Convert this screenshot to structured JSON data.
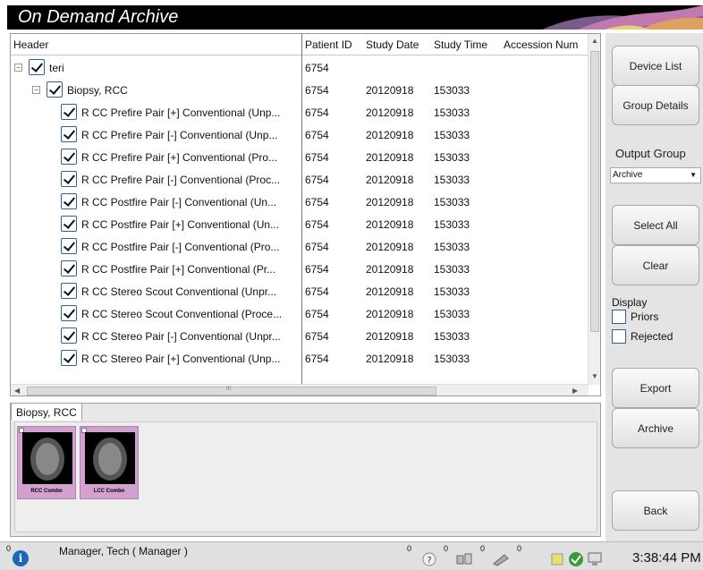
{
  "app": {
    "title": "On Demand Archive"
  },
  "tree": {
    "headers": [
      "Header",
      "Patient ID",
      "Study Date",
      "Study Time",
      "Accession Num"
    ],
    "rows": [
      {
        "label": "teri",
        "patient_id": "6754",
        "date": "",
        "time": "",
        "level": 0
      },
      {
        "label": "Biopsy, RCC",
        "patient_id": "6754",
        "date": "20120918",
        "time": "153033",
        "level": 1
      },
      {
        "label": "R CC Prefire Pair [+] Conventional (Unp...",
        "patient_id": "6754",
        "date": "20120918",
        "time": "153033",
        "level": 2
      },
      {
        "label": "R CC Prefire Pair [-] Conventional (Unp...",
        "patient_id": "6754",
        "date": "20120918",
        "time": "153033",
        "level": 2
      },
      {
        "label": "R CC Prefire Pair [+] Conventional (Pro...",
        "patient_id": "6754",
        "date": "20120918",
        "time": "153033",
        "level": 2
      },
      {
        "label": "R CC Prefire Pair [-] Conventional (Proc...",
        "patient_id": "6754",
        "date": "20120918",
        "time": "153033",
        "level": 2
      },
      {
        "label": "R CC Postfire Pair [-] Conventional (Un...",
        "patient_id": "6754",
        "date": "20120918",
        "time": "153033",
        "level": 2
      },
      {
        "label": "R CC Postfire Pair [+] Conventional (Un...",
        "patient_id": "6754",
        "date": "20120918",
        "time": "153033",
        "level": 2
      },
      {
        "label": "R CC Postfire Pair [-] Conventional (Pro...",
        "patient_id": "6754",
        "date": "20120918",
        "time": "153033",
        "level": 2
      },
      {
        "label": "R CC Postfire Pair [+] Conventional (Pr...",
        "patient_id": "6754",
        "date": "20120918",
        "time": "153033",
        "level": 2
      },
      {
        "label": "R CC Stereo Scout  Conventional (Unpr...",
        "patient_id": "6754",
        "date": "20120918",
        "time": "153033",
        "level": 2
      },
      {
        "label": "R CC Stereo Scout  Conventional (Proce...",
        "patient_id": "6754",
        "date": "20120918",
        "time": "153033",
        "level": 2
      },
      {
        "label": "R CC Stereo Pair [-] Conventional (Unpr...",
        "patient_id": "6754",
        "date": "20120918",
        "time": "153033",
        "level": 2
      },
      {
        "label": "R CC Stereo Pair [+] Conventional (Unp...",
        "patient_id": "6754",
        "date": "20120918",
        "time": "153033",
        "level": 2
      }
    ],
    "hscroll_mark": "III"
  },
  "preview": {
    "tab": "Biopsy, RCC",
    "thumbnails": [
      "RCC Combo",
      "LCC Combo"
    ]
  },
  "side": {
    "device_list": "Device List",
    "group_details": "Group Details",
    "output_group_label": "Output Group",
    "output_group_value": "Archive",
    "select_all": "Select All",
    "clear": "Clear",
    "display_label": "Display",
    "priors": "Priors",
    "rejected": "Rejected",
    "export": "Export",
    "archive": "Archive",
    "back": "Back"
  },
  "status": {
    "count0": "0",
    "user": "Manager, Tech ( Manager )",
    "c1": "0",
    "c2": "0",
    "c3": "0",
    "c4": "0",
    "time": "3:38:44 PM"
  },
  "colors": {
    "title_bg": "#000000",
    "thumb_bg": "#d4a0d0",
    "info_icon": "#1a66b8"
  }
}
